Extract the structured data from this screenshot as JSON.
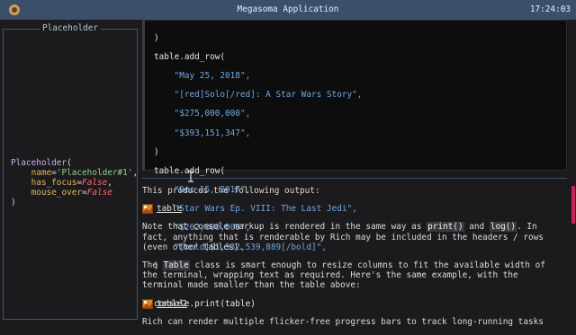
{
  "window": {
    "title": "Megasoma Application",
    "clock": "17:24:03"
  },
  "sidebar": {
    "title": "Placeholder",
    "repr": {
      "class_name": "Placeholder",
      "open": "(",
      "name_key": "name",
      "name_value": "'Placeholder#1'",
      "has_focus_key": "has_focus",
      "has_focus_value": "False",
      "mouse_over_key": "mouse_over",
      "mouse_over_value": "False",
      "close": ")"
    }
  },
  "code": {
    "lines": [
      ")",
      "table.add_row(",
      "\"May 25, 2018\",",
      "\"[red]Solo[/red]: A Star Wars Story\",",
      "\"$275,000,000\",",
      "\"$393,151,347\",",
      ")",
      "table.add_row(",
      "\"Dec 15, 2017\",",
      "\"Star Wars Ep. VIII: The Last Jedi\",",
      "\"$262,000,000\",",
      "\"[bold]$1,332,539,889[/bold]\",",
      ")",
      "console.print(table)"
    ]
  },
  "prose": {
    "output_intro": "This produces the following output:",
    "image1_label": "table",
    "para1_a": "Note that console markup is rendered in the same way as ",
    "para1_code1": "print()",
    "para1_b": " and ",
    "para1_code2": "log()",
    "para1_c": ". In fact, anything that is renderable by Rich may be included in the headers / rows (even other tables).",
    "para2_a": "The ",
    "para2_code": "Table",
    "para2_b": " class is smart enough to resize columns to fit the available width of the terminal, wrapping text as required. Here's the same example, with the terminal made smaller than the table above:",
    "image2_label": "table2",
    "para3": "Rich can render multiple flicker-free progress bars to track long-running tasks"
  },
  "colors": {
    "titlebar": "#3b4f6b",
    "scroll_thumb": "#c8245a",
    "code_string": "#6fa7e3"
  }
}
